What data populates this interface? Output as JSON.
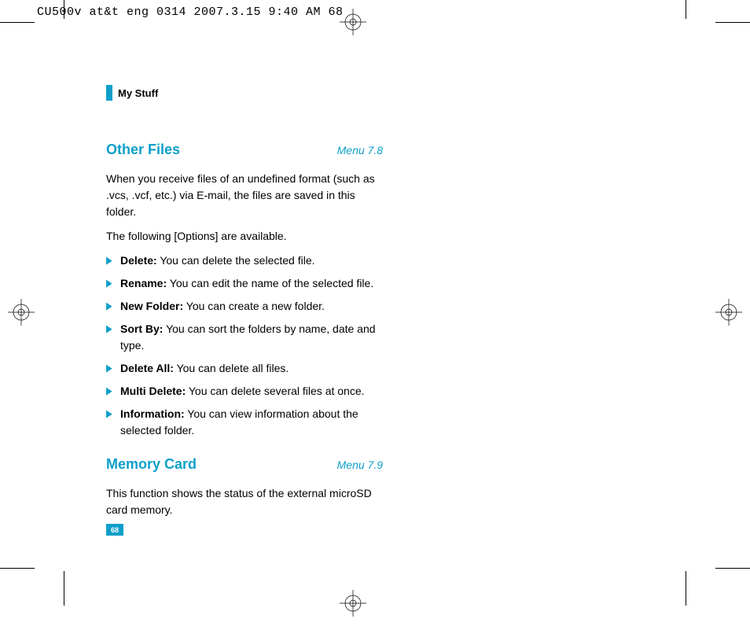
{
  "header": {
    "imprint": "CU500v at&t eng 0314  2007.3.15 9:40 AM      68"
  },
  "section": {
    "title": "My Stuff"
  },
  "topic1": {
    "title": "Other Files",
    "menu": "Menu 7.8",
    "intro": "When you receive files of an undefined format (such as .vcs, .vcf, etc.) via E-mail, the files are saved in this folder.",
    "lead": "The following [Options] are available.",
    "options": [
      {
        "label": "Delete:",
        "desc": " You can delete the selected file."
      },
      {
        "label": "Rename:",
        "desc": " You can edit the name of the selected file."
      },
      {
        "label": "New Folder:",
        "desc": " You can create a new folder."
      },
      {
        "label": "Sort By:",
        "desc": " You can sort the folders by name, date and type."
      },
      {
        "label": "Delete All:",
        "desc": " You can delete all files."
      },
      {
        "label": "Multi Delete:",
        "desc": " You can delete several files at once."
      },
      {
        "label": "Information:",
        "desc": " You can view information about the selected folder."
      }
    ]
  },
  "topic2": {
    "title": "Memory Card",
    "menu": "Menu 7.9",
    "body": "This function shows the status of the external microSD card memory."
  },
  "page": {
    "number": "68"
  },
  "colors": {
    "accent": "#0d9fc9"
  }
}
